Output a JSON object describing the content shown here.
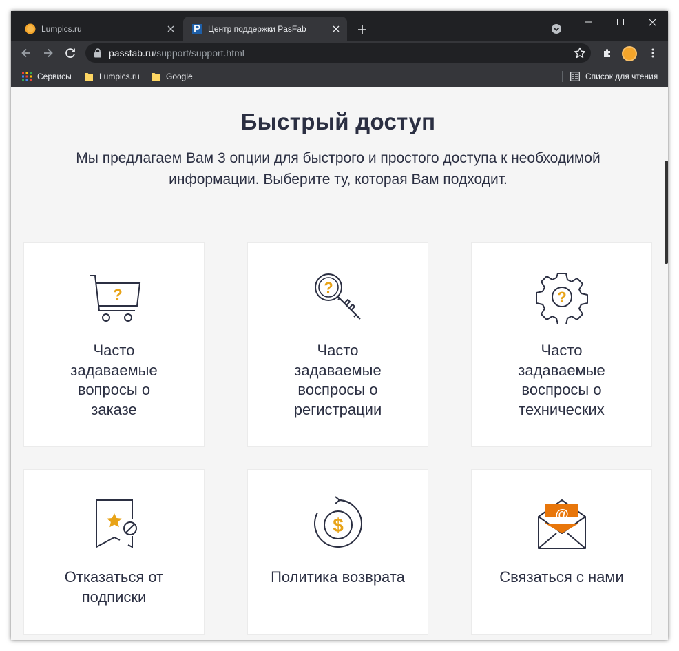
{
  "browser": {
    "tabs": [
      {
        "title": "Lumpics.ru",
        "active": false
      },
      {
        "title": "Центр поддержки PasFab",
        "active": true
      }
    ],
    "url_host": "passfab.ru",
    "url_path": "/support/support.html",
    "bookmarks": [
      {
        "label": "Сервисы"
      },
      {
        "label": "Lumpics.ru"
      },
      {
        "label": "Google"
      }
    ],
    "reading_list": "Список для чтения"
  },
  "page": {
    "title": "Быстрый доступ",
    "subtitle": "Мы предлагаем Вам 3 опции для быстрого и простого доступа к необходимой информации. Выберите ту, которая Вам подходит.",
    "cards": [
      {
        "label": "Часто задаваемые вопросы о заказе",
        "icon": "cart-question-icon"
      },
      {
        "label": "Часто задаваемые воспросы о регистрации",
        "icon": "key-question-icon"
      },
      {
        "label": "Часто задаваемые воспросы о технических",
        "icon": "gear-question-icon"
      },
      {
        "label": "Отказаться от подписки",
        "icon": "bookmark-cancel-icon"
      },
      {
        "label": "Политика возврата",
        "icon": "refund-dollar-icon"
      },
      {
        "label": "Связаться с нами",
        "icon": "email-at-icon"
      }
    ]
  },
  "colors": {
    "accent": "#e8a317",
    "orange": "#e8760a",
    "text": "#2b2f42",
    "chrome_dark": "#202124",
    "chrome_mid": "#35363a"
  }
}
